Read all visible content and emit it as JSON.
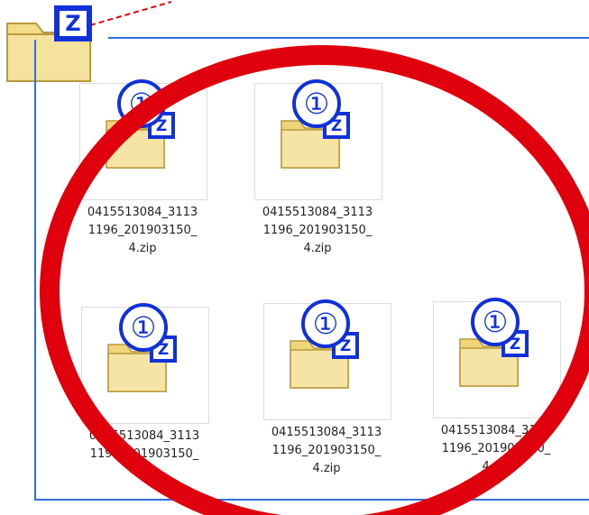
{
  "window": {
    "title_icon": "zip-folder-icon",
    "accent_color": "#2f6fe0",
    "highlight_color": "#e0000d"
  },
  "files": [
    {
      "name": "0415513084_3113\n1196_201903150_\n4.zip",
      "badge": "①"
    },
    {
      "name": "0415513084_3113\n1196_201903150_\n4.zip",
      "badge": "①"
    },
    {
      "name": "0415513084_3113\n1196_201903150_\n4.zip",
      "badge": "①"
    },
    {
      "name": "0415513084_3113\n1196_201903150_\n4.zip",
      "badge": "①"
    },
    {
      "name": "0415513084_3113\n1196_201903150_\n4.zip",
      "badge": "①"
    }
  ]
}
